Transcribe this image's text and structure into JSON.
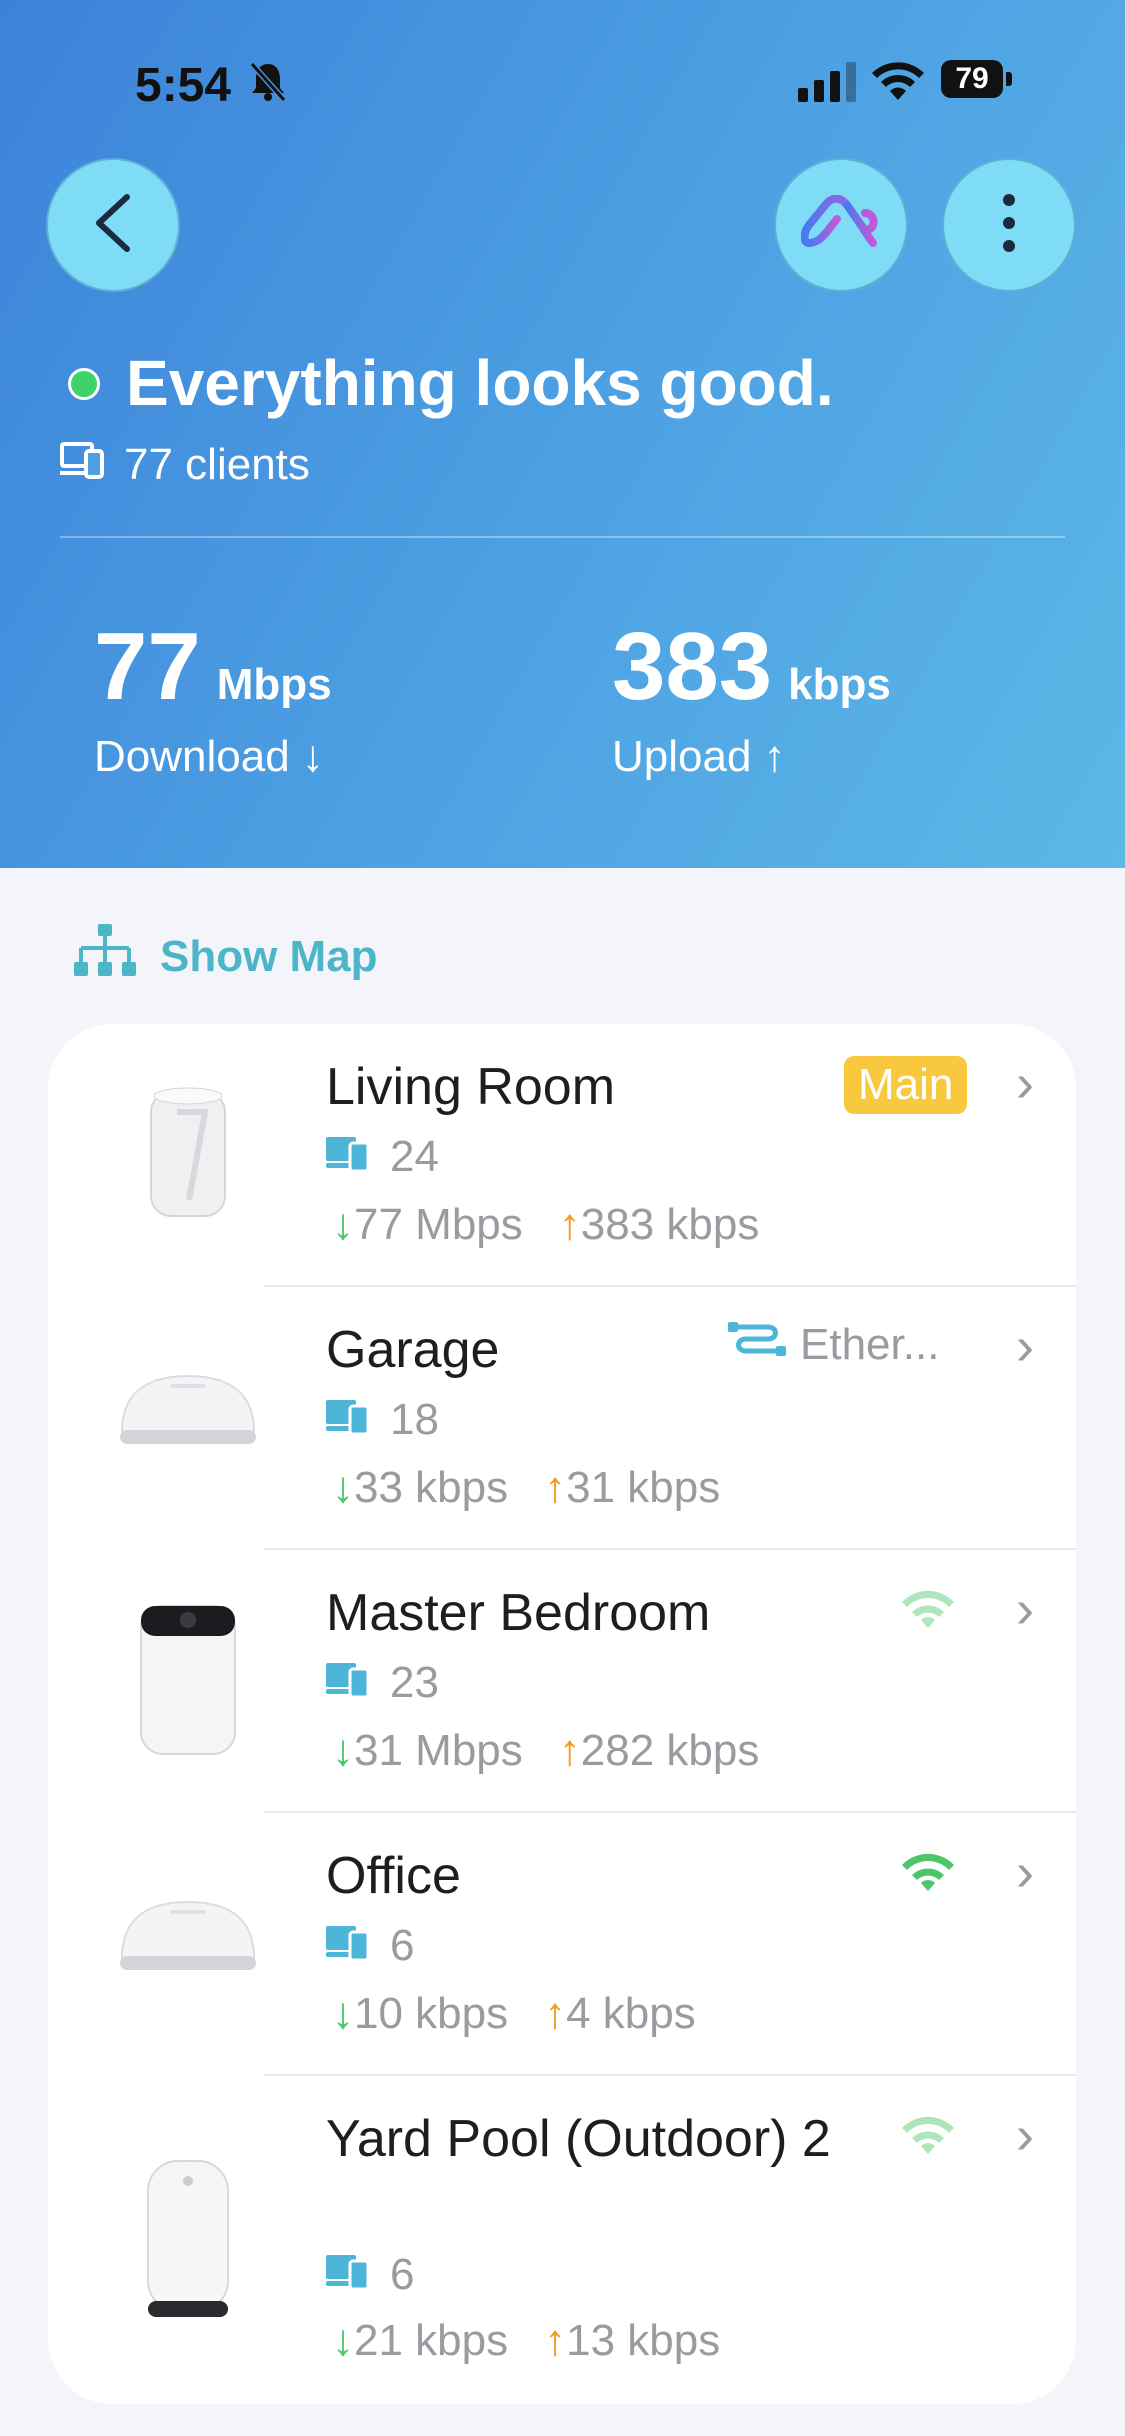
{
  "statusbar": {
    "time": "5:54",
    "battery": "79"
  },
  "header": {
    "status_message": "Everything looks good.",
    "clients": "77 clients",
    "download": {
      "value": "77",
      "unit": "Mbps",
      "label": "Download ↓"
    },
    "upload": {
      "value": "383",
      "unit": "kbps",
      "label": "Upload ↑"
    }
  },
  "show_map": "Show Map",
  "devices": [
    {
      "name": "Living Room",
      "clients": "24",
      "down": "↓77 Mbps",
      "up": "↑383 kbps",
      "badge": "Main"
    },
    {
      "name": "Garage",
      "clients": "18",
      "down": "↓33 kbps",
      "up": "↑31 kbps",
      "connection": "Ether..."
    },
    {
      "name": "Master Bedroom",
      "clients": "23",
      "down": "↓31 Mbps",
      "up": "↑282 kbps"
    },
    {
      "name": "Office",
      "clients": "6",
      "down": "↓10 kbps",
      "up": "↑4 kbps"
    },
    {
      "name": "Yard Pool (Outdoor) 2",
      "clients": "6",
      "down": "↓21 kbps",
      "up": "↑13 kbps"
    }
  ],
  "colors": {
    "header_top": "#3c82d9",
    "header_bottom": "#5cb8e6",
    "online_green": "#3dd36a",
    "main_badge": "#f8c93e",
    "accent_teal": "#4cb5c7"
  }
}
